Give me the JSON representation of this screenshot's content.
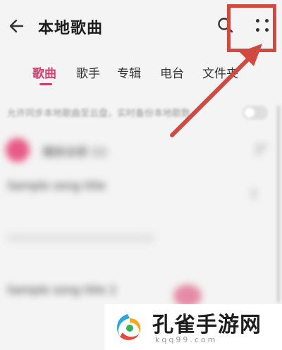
{
  "header": {
    "title": "本地歌曲",
    "back_icon": "arrow-left-icon",
    "search_icon": "search-icon",
    "more_icon": "more-dots-icon"
  },
  "tabs": [
    {
      "label": "歌曲",
      "active": true
    },
    {
      "label": "歌手",
      "active": false
    },
    {
      "label": "专辑",
      "active": false
    },
    {
      "label": "电台",
      "active": false
    },
    {
      "label": "文件夹",
      "active": false
    }
  ],
  "sync": {
    "label": "允许同步本地歌曲至云盘，实时备份本地歌数"
  },
  "list": {
    "play_all_label": "播放全部 (1)",
    "songs": [
      {
        "title": "Sample song title",
        "subtitle": ""
      },
      {
        "title": "Sample song title 2",
        "subtitle": ""
      }
    ]
  },
  "watermark": {
    "text": "孔雀手游网",
    "url": "kqq99.com"
  },
  "colors": {
    "accent": "#d43f6d",
    "annotation": "#d24a3f",
    "background": "#f4f4f4"
  }
}
